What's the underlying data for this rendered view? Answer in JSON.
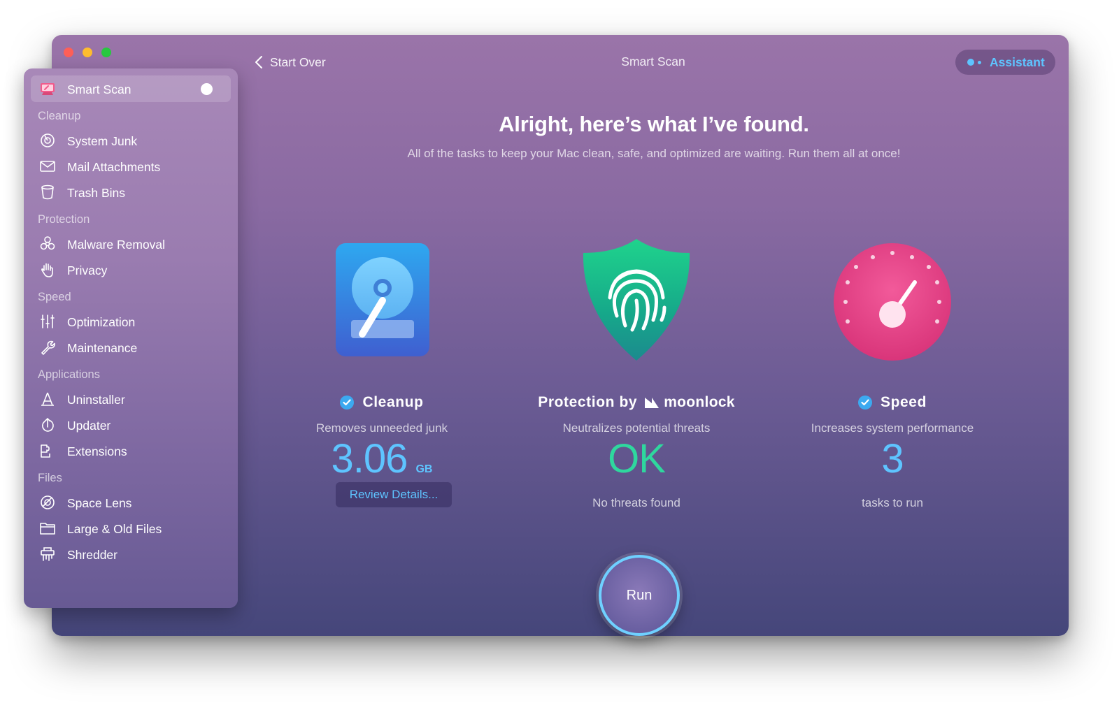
{
  "window": {
    "title": "Smart Scan",
    "back_label": "Start Over",
    "assistant_label": "Assistant"
  },
  "sidebar": {
    "active_item": "Smart Scan",
    "sections": [
      {
        "label": "Cleanup",
        "items": [
          {
            "label": "System Junk",
            "icon": "system-junk-icon"
          },
          {
            "label": "Mail Attachments",
            "icon": "mail-icon"
          },
          {
            "label": "Trash Bins",
            "icon": "trash-icon"
          }
        ]
      },
      {
        "label": "Protection",
        "items": [
          {
            "label": "Malware Removal",
            "icon": "biohazard-icon"
          },
          {
            "label": "Privacy",
            "icon": "hand-icon"
          }
        ]
      },
      {
        "label": "Speed",
        "items": [
          {
            "label": "Optimization",
            "icon": "sliders-icon"
          },
          {
            "label": "Maintenance",
            "icon": "wrench-icon"
          }
        ]
      },
      {
        "label": "Applications",
        "items": [
          {
            "label": "Uninstaller",
            "icon": "uninstaller-icon"
          },
          {
            "label": "Updater",
            "icon": "updater-icon"
          },
          {
            "label": "Extensions",
            "icon": "extensions-icon"
          }
        ]
      },
      {
        "label": "Files",
        "items": [
          {
            "label": "Space Lens",
            "icon": "space-lens-icon"
          },
          {
            "label": "Large & Old Files",
            "icon": "folder-icon"
          },
          {
            "label": "Shredder",
            "icon": "shredder-icon"
          }
        ]
      }
    ]
  },
  "main": {
    "headline": "Alright, here’s what I’ve found.",
    "subline": "All of the tasks to keep your Mac clean, safe, and optimized are waiting. Run them all at once!",
    "cards": [
      {
        "title": "Cleanup",
        "subtitle": "Removes unneeded junk",
        "value": "3.06",
        "unit": "GB",
        "value_color": "#5ec4ff",
        "button": "Review Details...",
        "icon": "hard-drive-icon"
      },
      {
        "title": "Protection by",
        "brand": "moonlock",
        "subtitle": "Neutralizes potential threats",
        "value": "OK",
        "value_color": "#2fd79e",
        "note": "No threats found",
        "icon": "fingerprint-shield-icon"
      },
      {
        "title": "Speed",
        "subtitle": "Increases system performance",
        "value": "3",
        "value_color": "#5ec4ff",
        "note": "tasks to run",
        "icon": "speedometer-icon"
      }
    ],
    "run_label": "Run"
  }
}
